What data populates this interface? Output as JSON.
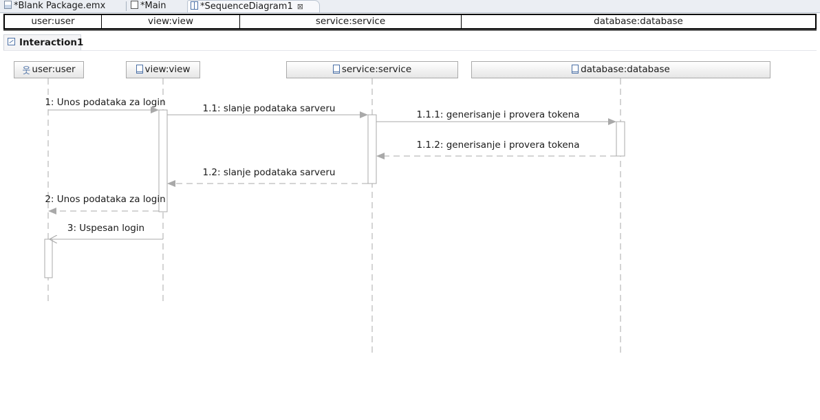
{
  "tabs": [
    {
      "label": "*Blank Package.emx",
      "icon": "emx-file-icon",
      "active": false
    },
    {
      "label": "*Main",
      "icon": "document-icon",
      "active": false
    },
    {
      "label": "*SequenceDiagram1",
      "icon": "sequence-diagram-icon",
      "active": true
    }
  ],
  "header_cells": [
    "user:user",
    "view:view",
    "service:service",
    "database:database"
  ],
  "interaction": {
    "label": "Interaction1",
    "icon": "interaction-frame-icon"
  },
  "lifelines": [
    {
      "id": "user",
      "label": "user:user",
      "icon": "actor-icon"
    },
    {
      "id": "view",
      "label": "view:view",
      "icon": "class-icon"
    },
    {
      "id": "service",
      "label": "service:service",
      "icon": "class-icon"
    },
    {
      "id": "database",
      "label": "database:database",
      "icon": "class-icon"
    }
  ],
  "messages": [
    {
      "label": "1: Unos podataka za login",
      "from": "user",
      "to": "view",
      "kind": "sync"
    },
    {
      "label": "1.1: slanje podataka sarveru",
      "from": "view",
      "to": "service",
      "kind": "sync"
    },
    {
      "label": "1.1.1: generisanje i provera tokena",
      "from": "service",
      "to": "database",
      "kind": "sync"
    },
    {
      "label": "1.1.2: generisanje i provera tokena",
      "from": "database",
      "to": "service",
      "kind": "reply"
    },
    {
      "label": "1.2: slanje podataka sarveru",
      "from": "service",
      "to": "view",
      "kind": "reply"
    },
    {
      "label": "2: Unos podataka za login",
      "from": "view",
      "to": "user",
      "kind": "reply"
    },
    {
      "label": "3: Uspesan login",
      "from": "view",
      "to": "user",
      "kind": "async"
    }
  ],
  "colors": {
    "line": "#a9a9a9",
    "icon": "#4a6fa5",
    "frame_border": "#000000"
  }
}
